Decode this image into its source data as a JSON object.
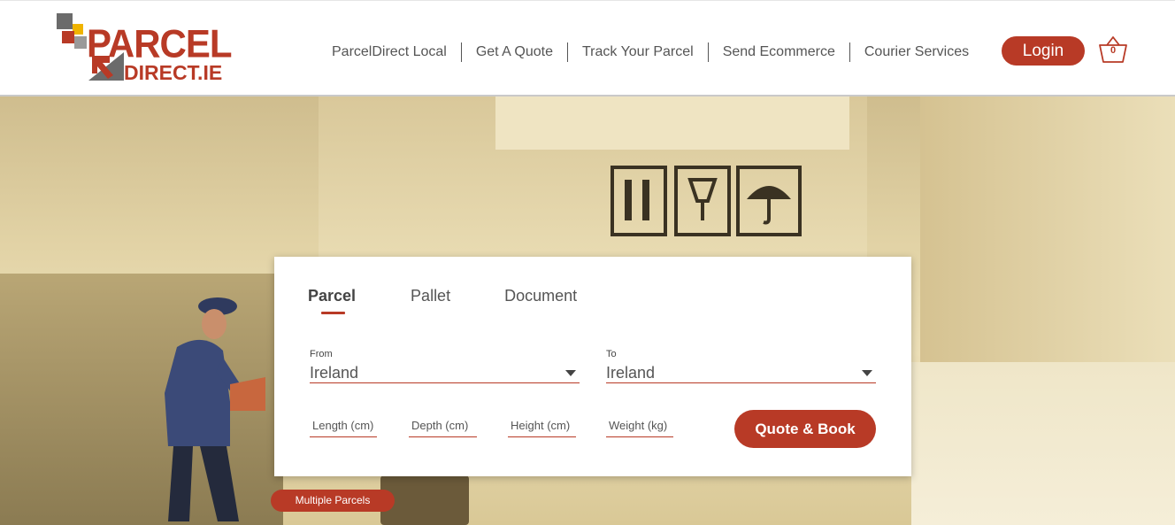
{
  "logo": {
    "line1": "PARCEL",
    "line2": "DIRECT.IE",
    "colors": {
      "red": "#b83a26",
      "gray": "#6b6b6b",
      "yellow": "#f0b400"
    }
  },
  "nav": {
    "items": [
      {
        "label": "ParcelDirect Local"
      },
      {
        "label": "Get A Quote"
      },
      {
        "label": "Track Your Parcel"
      },
      {
        "label": "Send Ecommerce"
      },
      {
        "label": "Courier Services"
      }
    ],
    "login_label": "Login",
    "cart_count": "0",
    "cart_icon": "basket-icon"
  },
  "quote_form": {
    "tabs": [
      {
        "label": "Parcel",
        "active": true
      },
      {
        "label": "Pallet",
        "active": false
      },
      {
        "label": "Document",
        "active": false
      }
    ],
    "from": {
      "label": "From",
      "value": "Ireland"
    },
    "to": {
      "label": "To",
      "value": "Ireland"
    },
    "dimensions": {
      "length_placeholder": "Length (cm)",
      "depth_placeholder": "Depth (cm)",
      "height_placeholder": "Height (cm)",
      "weight_placeholder": "Weight (kg)"
    },
    "submit_label": "Quote & Book"
  },
  "multiple_parcels_label": "Multiple Parcels",
  "colors": {
    "accent": "#b83a26",
    "nav_text": "#555555"
  }
}
